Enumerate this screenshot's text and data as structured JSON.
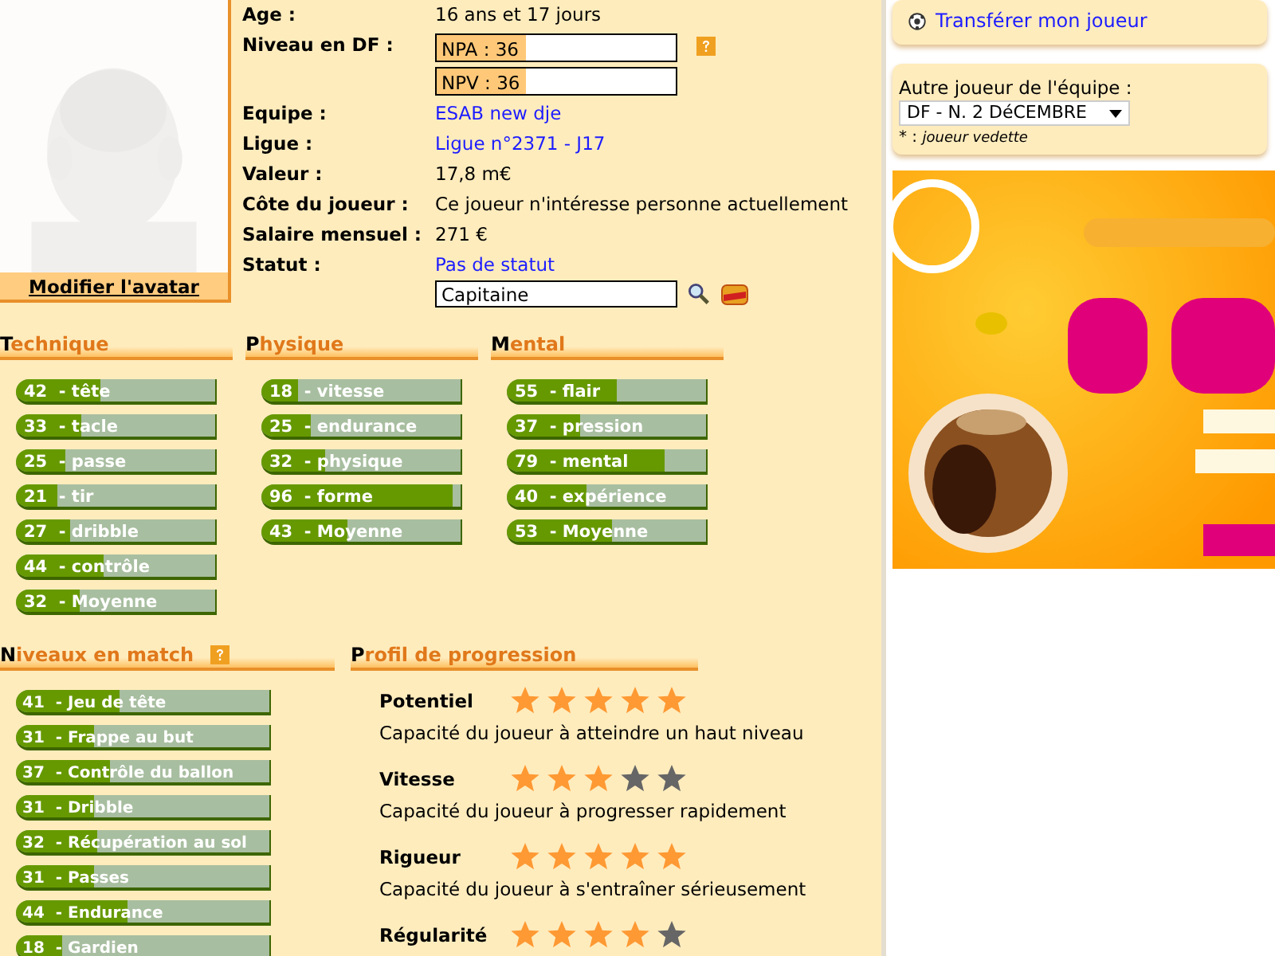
{
  "info": [
    {
      "kind": "text",
      "label": "Age :",
      "value": "16 ans et 17 jours"
    },
    {
      "kind": "levels",
      "label": "Niveau en DF :",
      "meters": [
        {
          "text": "NPA : 36",
          "level": 0.37
        },
        {
          "text": "NPV : 36",
          "level": 0.37
        }
      ]
    },
    {
      "kind": "link",
      "label": "Equipe :",
      "value": "ESAB new dje"
    },
    {
      "kind": "link",
      "label": "Ligue :",
      "value": "Ligue n°2371 - J17"
    },
    {
      "kind": "text",
      "label": "Valeur :",
      "value": "17,8 m€"
    },
    {
      "kind": "text",
      "label": "Côte du joueur :",
      "value": "Ce joueur n'intéresse personne actuellement"
    },
    {
      "kind": "text",
      "label": "Salaire mensuel :",
      "value": "271 €"
    },
    {
      "kind": "status",
      "label": "Statut :",
      "value": "Pas de statut",
      "field_value": "Capitaine"
    }
  ],
  "avatar": {
    "link": "Modifier l'avatar"
  },
  "sections": [
    {
      "title": "Technique",
      "bars": [
        {
          "label": "42  - tête",
          "level": 0.42
        },
        {
          "label": "33  - tacle",
          "level": 0.33
        },
        {
          "label": "25  - passe",
          "level": 0.25
        },
        {
          "label": "21  - tir",
          "level": 0.21
        },
        {
          "label": "27  - dribble",
          "level": 0.27
        },
        {
          "label": "44  - contrôle",
          "level": 0.44
        },
        {
          "label": "32  - Moyenne",
          "level": 0.32
        }
      ]
    },
    {
      "title": "Physique",
      "bars": [
        {
          "label": "18  - vitesse",
          "level": 0.18
        },
        {
          "label": "25  - endurance",
          "level": 0.25
        },
        {
          "label": "32  - physique",
          "level": 0.32
        },
        {
          "label": "96  - forme",
          "level": 0.96
        },
        {
          "label": "43  - Moyenne",
          "level": 0.43
        }
      ]
    },
    {
      "title": "Mental",
      "bars": [
        {
          "label": "55  - flair",
          "level": 0.55
        },
        {
          "label": "37  - pression",
          "level": 0.37
        },
        {
          "label": "79  - mental",
          "level": 0.79
        },
        {
          "label": "40  - expérience",
          "level": 0.4
        },
        {
          "label": "53  - Moyenne",
          "level": 0.53
        }
      ]
    }
  ],
  "match": {
    "title": "Niveaux en match",
    "bars": [
      {
        "label": "41  - Jeu de tête",
        "level": 0.41
      },
      {
        "label": "31  - Frappe au but",
        "level": 0.31
      },
      {
        "label": "37  - Contrôle du ballon",
        "level": 0.37
      },
      {
        "label": "31  - Dribble",
        "level": 0.31
      },
      {
        "label": "32  - Récupération au sol",
        "level": 0.32
      },
      {
        "label": "31  - Passes",
        "level": 0.31
      },
      {
        "label": "44  - Endurance",
        "level": 0.44
      },
      {
        "label": "18  - Gardien",
        "level": 0.18
      }
    ]
  },
  "profile": {
    "title": "Profil de progression",
    "items": [
      {
        "name": "Potentiel",
        "stars": 5,
        "description": "Capacité du joueur à atteindre un haut niveau"
      },
      {
        "name": "Vitesse",
        "stars": 3,
        "description": "Capacité du joueur à progresser rapidement"
      },
      {
        "name": "Rigueur",
        "stars": 5,
        "description": "Capacité du joueur à s'entraîner sérieusement"
      },
      {
        "name": "Régularité",
        "stars": 4
      }
    ]
  },
  "sidebar": {
    "links": [
      "Transférer mon joueur"
    ],
    "other_label": "Autre joueur de l'équipe :",
    "other_value": "DF - N. 2 DéCEMBRE",
    "legend_mark": "* :",
    "legend_text": "joueur vedette"
  }
}
